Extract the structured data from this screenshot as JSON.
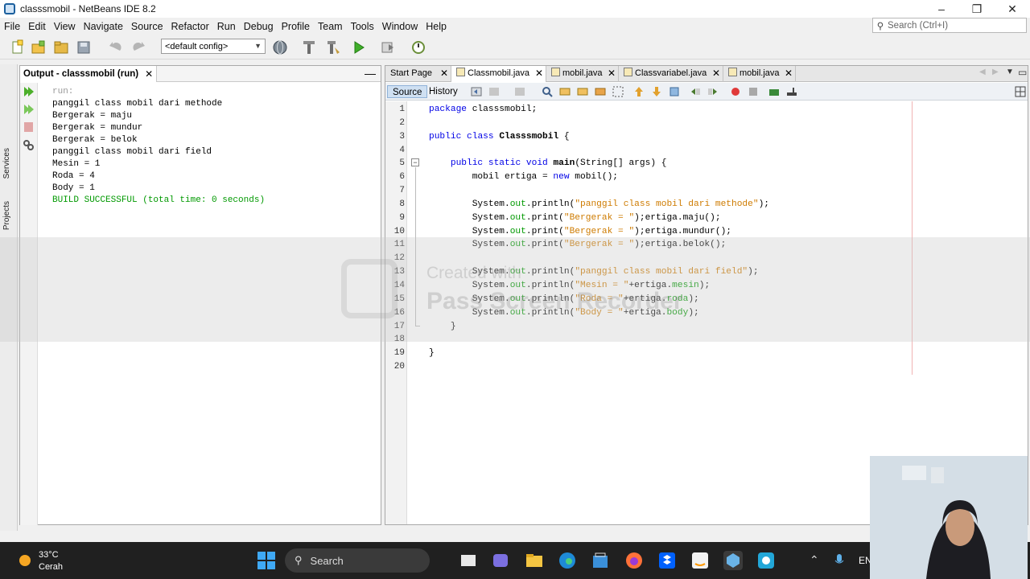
{
  "window": {
    "title": "classsmobil - NetBeans IDE 8.2",
    "controls": [
      "–",
      "❐",
      "✕"
    ]
  },
  "menu": [
    "File",
    "Edit",
    "View",
    "Navigate",
    "Source",
    "Refactor",
    "Run",
    "Debug",
    "Profile",
    "Team",
    "Tools",
    "Window",
    "Help"
  ],
  "search": {
    "placeholder": "Search (Ctrl+I)"
  },
  "toolbar": {
    "config": "<default config>"
  },
  "side_tabs": [
    "Services",
    "Projects"
  ],
  "output": {
    "title": "Output - classsmobil (run)",
    "close": "✕",
    "minimize": "—",
    "lines": [
      {
        "text": "run:",
        "style": "dim"
      },
      {
        "text": "panggil class mobil dari methode",
        "style": "normal"
      },
      {
        "text": "Bergerak = maju",
        "style": "normal"
      },
      {
        "text": "Bergerak = mundur",
        "style": "normal"
      },
      {
        "text": "Bergerak = belok",
        "style": "normal"
      },
      {
        "text": "panggil class mobil dari field",
        "style": "normal"
      },
      {
        "text": "Mesin = 1",
        "style": "normal"
      },
      {
        "text": "Roda = 4",
        "style": "normal"
      },
      {
        "text": "Body = 1",
        "style": "normal"
      },
      {
        "text": "BUILD SUCCESSFUL (total time: 0 seconds)",
        "style": "success"
      }
    ]
  },
  "editor": {
    "tabs": [
      {
        "label": "Start Page",
        "active": false
      },
      {
        "label": "Classmobil.java",
        "active": true
      },
      {
        "label": "mobil.java",
        "active": false
      },
      {
        "label": "Classvariabel.java",
        "active": false
      },
      {
        "label": "mobil.java",
        "active": false
      }
    ],
    "source_label": "Source",
    "history_label": "History",
    "line_count": 20,
    "code_lines": [
      "package classsmobil;",
      "",
      "public class Classsmobil {",
      "",
      "    public static void main(String[] args) {",
      "        mobil ertiga = new mobil();",
      "",
      "        System.out.println(\"panggil class mobil dari methode\");",
      "        System.out.print(\"Bergerak = \");ertiga.maju();",
      "        System.out.print(\"Bergerak = \");ertiga.mundur();",
      "        System.out.print(\"Bergerak = \");ertiga.belok();",
      "",
      "        System.out.println(\"panggil class mobil dari field\");",
      "        System.out.println(\"Mesin = \"+ertiga.mesin);",
      "        System.out.println(\"Roda = \"+ertiga.roda);",
      "        System.out.println(\"Body = \"+ertiga.body);",
      "    }",
      "",
      "}",
      ""
    ]
  },
  "watermark": {
    "line1": "Created with",
    "line2": "Pass Screen Recorder"
  },
  "taskbar": {
    "weather_temp": "33°C",
    "weather_desc": "Cerah",
    "search_label": "Search",
    "lang": "EN"
  },
  "colors": {
    "keyword": "#0000e6",
    "string": "#ce7b00",
    "field": "#009900",
    "success": "#009900"
  }
}
